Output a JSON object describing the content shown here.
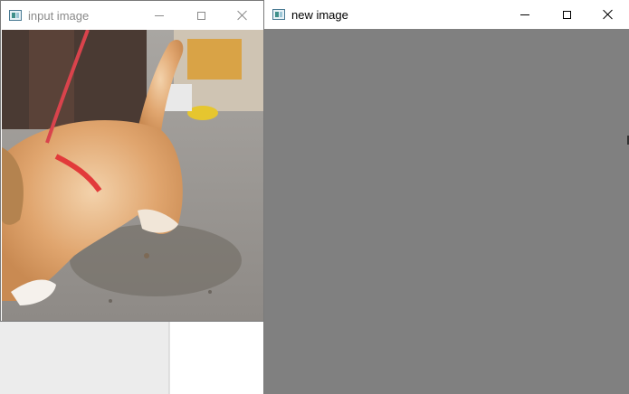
{
  "windows": {
    "input": {
      "title": "input image",
      "controls": {
        "minimize": "minimize",
        "maximize": "maximize",
        "close": "close"
      }
    },
    "new": {
      "title": "new image",
      "canvas_color": "#808080",
      "controls": {
        "minimize": "minimize",
        "maximize": "maximize",
        "close": "close"
      }
    }
  },
  "icons": {
    "app": "app-window-icon",
    "minimize": "minimize-icon",
    "maximize": "maximize-icon",
    "close": "close-icon"
  },
  "photo": {
    "subject": "cat-photo"
  }
}
